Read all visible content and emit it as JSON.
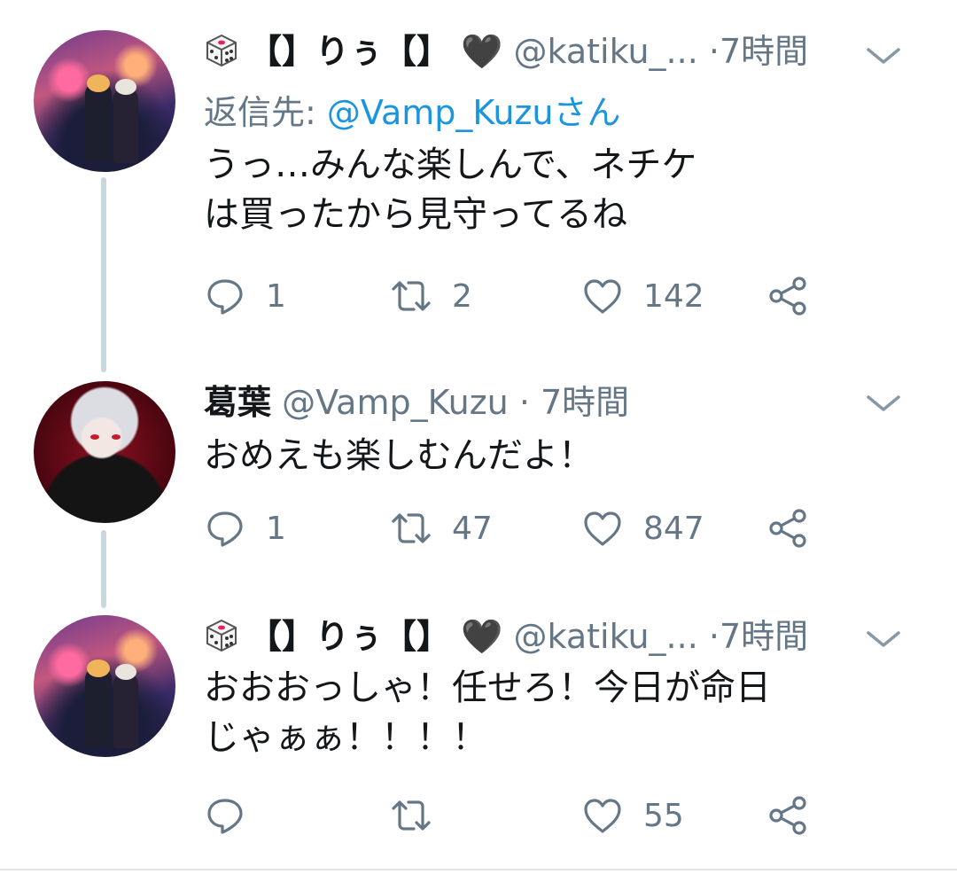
{
  "tweets": [
    {
      "name": "【】りぅ【】",
      "handle": "@katiku_...",
      "sep": "·",
      "time": "7時間",
      "reply_to_label": "返信先:",
      "reply_to_link": "@Vamp_Kuzuさん",
      "body": "うっ…みんな楽しんで、ネチケは買ったから見守ってるね",
      "replies": "1",
      "retweets": "2",
      "likes": "142",
      "heart_glyph": "🖤"
    },
    {
      "name": "葛葉",
      "handle": "@Vamp_Kuzu",
      "sep": "·",
      "time": "7時間",
      "body": "おめえも楽しむんだよ！",
      "replies": "1",
      "retweets": "47",
      "likes": "847"
    },
    {
      "name": "【】りぅ【】",
      "handle": "@katiku_...",
      "sep": "·",
      "time": "7時間",
      "body": "おおおっしゃ！任せろ！今日が命日\nじゃぁぁ！！！！",
      "replies": "",
      "retweets": "",
      "likes": "55",
      "heart_glyph": "🖤"
    }
  ],
  "colors": {
    "primary_text": "#14171a",
    "secondary_text": "#657786",
    "link": "#1b95e0",
    "thread_line": "#ccd6dd"
  },
  "icons": {
    "reply": "speech-bubble-icon",
    "retweet": "retweet-arrows-icon",
    "like": "heart-outline-icon",
    "share": "share-nodes-icon",
    "menu": "chevron-down-icon",
    "emoji_dice": "dice-icon"
  }
}
